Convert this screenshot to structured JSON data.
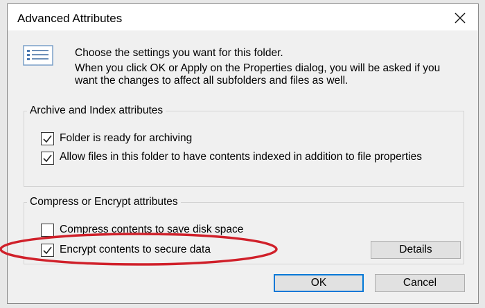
{
  "window": {
    "title": "Advanced Attributes",
    "close_icon": "close-icon"
  },
  "intro": {
    "icon": "attributes-list-icon",
    "line1": "Choose the settings you want for this folder.",
    "line2": "When you click OK or Apply on the Properties dialog, you will be asked if you want the changes to affect all subfolders and files as well."
  },
  "archive_group": {
    "legend": "Archive and Index attributes",
    "items": [
      {
        "label": "Folder is ready for archiving",
        "checked": true
      },
      {
        "label": "Allow files in this folder to have contents indexed in addition to file properties",
        "checked": true
      }
    ]
  },
  "compress_group": {
    "legend": "Compress or Encrypt attributes",
    "items": [
      {
        "label": "Compress contents to save disk space",
        "checked": false
      },
      {
        "label": "Encrypt contents to secure data",
        "checked": true
      }
    ],
    "details_label": "Details"
  },
  "buttons": {
    "ok_label": "OK",
    "cancel_label": "Cancel"
  },
  "colors": {
    "dialog_bg": "#f0f0f0",
    "focus_border": "#0078d7",
    "highlight_ellipse": "#d0202a"
  }
}
